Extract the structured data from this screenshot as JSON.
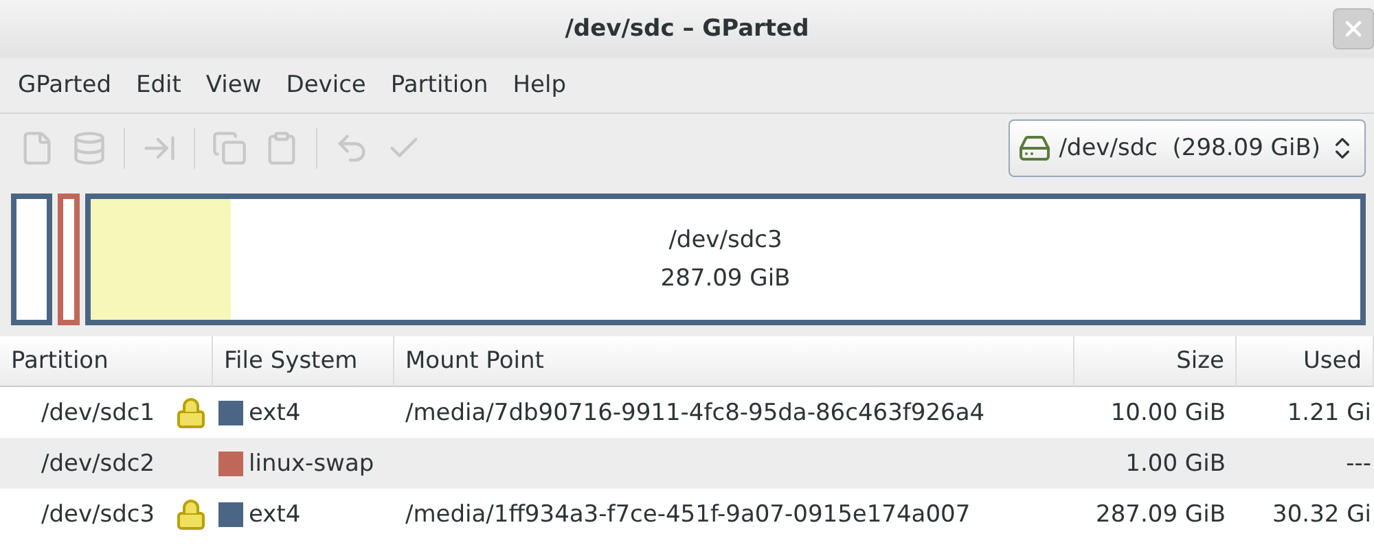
{
  "window": {
    "title": "/dev/sdc – GParted"
  },
  "menu": [
    "GParted",
    "Edit",
    "View",
    "Device",
    "Partition",
    "Help"
  ],
  "toolbar": [
    {
      "kind": "new",
      "disabled": true
    },
    {
      "kind": "delete",
      "disabled": true
    },
    {
      "kind": "resize",
      "disabled": true
    },
    {
      "kind": "copy",
      "disabled": true
    },
    {
      "kind": "paste",
      "disabled": true
    },
    {
      "kind": "undo",
      "disabled": true
    },
    {
      "kind": "apply",
      "disabled": true
    }
  ],
  "device": {
    "path": "/dev/sdc",
    "size": "(298.09 GiB)"
  },
  "disk_map": [
    {
      "color": "#4a6684"
    },
    {
      "color": "#c0675a"
    },
    {
      "color": "#4a6684",
      "level": 0.11,
      "name": "/dev/sdc3",
      "size": "287.09 GiB"
    }
  ],
  "table": {
    "columns": [
      "Partition",
      "File System",
      "Mount Point",
      "Size",
      "Used"
    ],
    "rows": [
      {
        "partition": "/dev/sdc1",
        "mounted": true,
        "fs": "ext4",
        "color": "#4a6684",
        "mount": "/media/7db90716-9911-4fc8-95da-86c463f926a4",
        "size": "10.00 GiB",
        "used": "1.21 Gi"
      },
      {
        "partition": "/dev/sdc2",
        "mounted": false,
        "fs": "linux-swap",
        "color": "#c0675a",
        "mount": "",
        "size": "1.00 GiB",
        "used": "---"
      },
      {
        "partition": "/dev/sdc3",
        "mounted": true,
        "fs": "ext4",
        "color": "#4a6684",
        "mount": "/media/1ff934a3-f7ce-451f-9a07-0915e174a007",
        "size": "287.09 GiB",
        "used": "30.32 Gi"
      }
    ]
  }
}
